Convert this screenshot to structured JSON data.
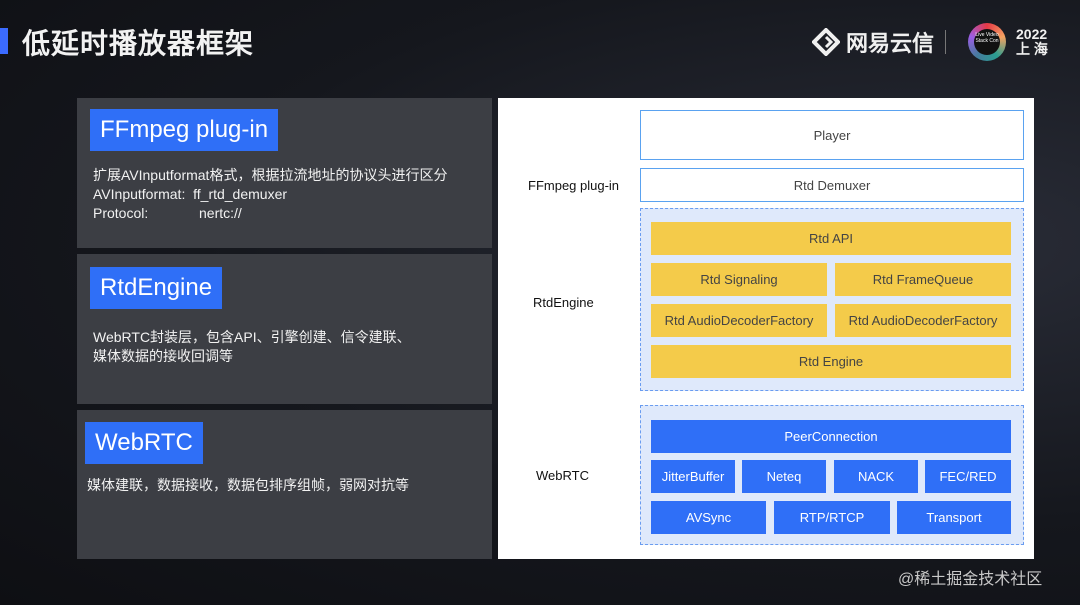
{
  "header": {
    "title": "低延时播放器框架",
    "brand": "网易云信",
    "conference_badge": "Live Video Stack Con",
    "conference_year": "2022",
    "conference_city": "上 海"
  },
  "panels": [
    {
      "tag": "FFmpeg plug-in",
      "lines": [
        "扩展AVInputformat格式，根据拉流地址的协议头进行区分"
      ],
      "fields": [
        {
          "key": "AVInputformat:",
          "value": "ff_rtd_demuxer"
        },
        {
          "key": "Protocol:",
          "value": "nertc://"
        }
      ]
    },
    {
      "tag": "RtdEngine",
      "lines": [
        "WebRTC封装层，包含API、引擎创建、信令建联、",
        "媒体数据的接收回调等"
      ]
    },
    {
      "tag": "WebRTC",
      "lines": [
        "媒体建联，数据接收，数据包排序组帧，弱网对抗等"
      ]
    }
  ],
  "diagram": {
    "layer_labels": {
      "ffmpeg": "FFmpeg plug-in",
      "rtdengine": "RtdEngine",
      "webrtc": "WebRTC"
    },
    "player": "Player",
    "rtd_demuxer": "Rtd Demuxer",
    "rtdengine_blocks": {
      "api": "Rtd API",
      "signaling": "Rtd Signaling",
      "frame_queue": "Rtd FrameQueue",
      "audio_decoder_left": "Rtd AudioDecoderFactory",
      "audio_decoder_right": "Rtd AudioDecoderFactory",
      "engine": "Rtd Engine"
    },
    "webrtc_blocks": {
      "peer_connection": "PeerConnection",
      "jitter_buffer": "JitterBuffer",
      "neteq": "Neteq",
      "nack": "NACK",
      "fec_red": "FEC/RED",
      "avsync": "AVSync",
      "rtp_rtcp": "RTP/RTCP",
      "transport": "Transport"
    },
    "colors": {
      "accent_blue": "#2f6ff7",
      "block_yellow": "#f4cb4a",
      "group_fill": "#dfe9fb"
    }
  },
  "watermark": "@稀土掘金技术社区"
}
